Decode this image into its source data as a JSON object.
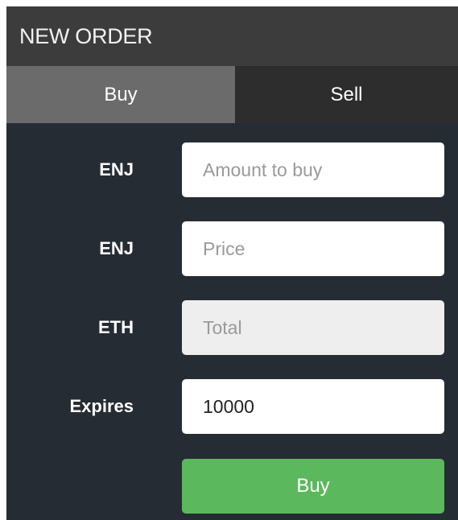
{
  "header": {
    "title": "NEW ORDER"
  },
  "tabs": [
    {
      "label": "Buy",
      "active": true
    },
    {
      "label": "Sell",
      "active": false
    }
  ],
  "form": {
    "rows": [
      {
        "label": "ENJ",
        "placeholder": "Amount to buy",
        "value": ""
      },
      {
        "label": "ENJ",
        "placeholder": "Price",
        "value": ""
      },
      {
        "label": "ETH",
        "placeholder": "Total",
        "value": ""
      },
      {
        "label": "Expires",
        "placeholder": "",
        "value": "10000"
      }
    ],
    "submit_label": "Buy"
  },
  "colors": {
    "panel_bg": "#262c33",
    "header_bg": "#3c3c3c",
    "tab_active_bg": "#6b6b6b",
    "tab_inactive_bg": "#2d2d2d",
    "submit_bg": "#5cb85c",
    "disabled_input_bg": "#eeeeee"
  }
}
